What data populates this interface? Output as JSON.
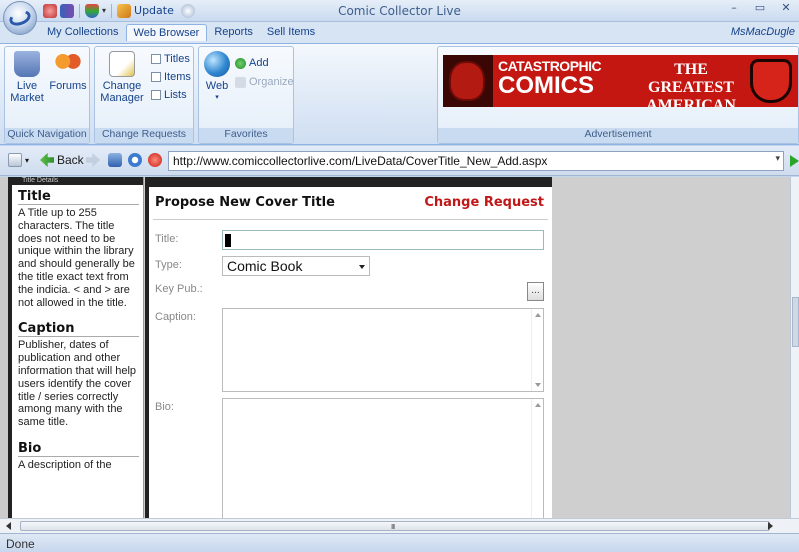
{
  "window": {
    "title": "Comic Collector Live",
    "update_label": "Update",
    "user": "MsMacDugle",
    "minimize": "–",
    "restore": "▭",
    "close": "✕"
  },
  "tabs": [
    "My Collections",
    "Web Browser",
    "Reports",
    "Sell Items"
  ],
  "ribbon": {
    "quick_nav": {
      "label": "Quick Navigation",
      "live_market": "Live Market",
      "forums": "Forums"
    },
    "change_requests": {
      "label": "Change Requests",
      "change_manager": "Change Manager",
      "titles": "Titles",
      "items": "Items",
      "lists": "Lists"
    },
    "favorites": {
      "label": "Favorites",
      "web": "Web",
      "add": "Add",
      "organize": "Organize"
    },
    "advertisement": {
      "label": "Advertisement",
      "line1": "CATASTROPHIC",
      "line2": "COMICS",
      "line3": "THE GREATEST",
      "line4": "AMERICAN HERO"
    }
  },
  "nav": {
    "back": "Back",
    "url": "http://www.comiccollectorlive.com/LiveData/CoverTitle_New_Add.aspx"
  },
  "left_panel": {
    "header": "Title Details",
    "sections": [
      {
        "heading": "Title",
        "text": "A Title up to 255 characters. The title does not need to be unique within the library and should generally be the title exact text from the indicia. < and > are not allowed in the title."
      },
      {
        "heading": "Caption",
        "text": "Publisher, dates of publication and other information that will help users identify the cover title / series correctly among many with the same title."
      },
      {
        "heading": "Bio",
        "text": "A description of the"
      }
    ]
  },
  "form": {
    "title": "Propose New Cover Title",
    "badge": "Change Request",
    "fields": {
      "title_label": "Title:",
      "title_value": "",
      "type_label": "Type:",
      "type_value": "Comic Book",
      "keypub_label": "Key Pub.:",
      "keypub_button": "...",
      "caption_label": "Caption:",
      "bio_label": "Bio:"
    }
  },
  "hscroll_grip": "III",
  "status": "Done",
  "colors": {
    "accent": "#15428b",
    "change_request": "#c01818",
    "banner": "#c41712"
  }
}
